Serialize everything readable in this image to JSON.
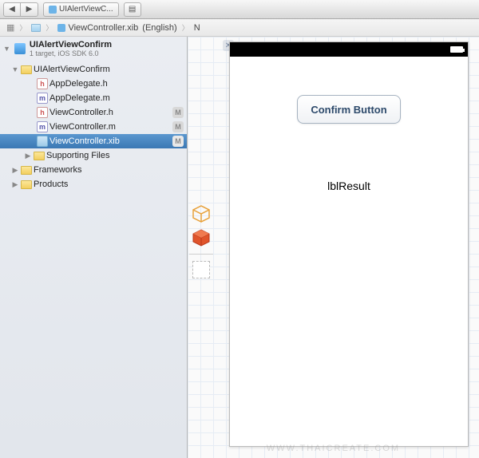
{
  "toolbar": {
    "tab_label": "UIAlertViewC..."
  },
  "breadcrumb": {
    "seg1": "ViewController.xib",
    "seg2": "(English)",
    "seg3_prefix": "N"
  },
  "project": {
    "name": "UIAlertViewConfirm",
    "subtitle": "1 target, iOS SDK 6.0"
  },
  "tree": {
    "root": "UIAlertViewConfirm",
    "files": [
      {
        "name": "AppDelegate.h",
        "type": "h",
        "badge": ""
      },
      {
        "name": "AppDelegate.m",
        "type": "m",
        "badge": ""
      },
      {
        "name": "ViewController.h",
        "type": "h",
        "badge": "M"
      },
      {
        "name": "ViewController.m",
        "type": "m",
        "badge": "M"
      },
      {
        "name": "ViewController.xib",
        "type": "xib",
        "badge": "M",
        "selected": true
      }
    ],
    "supporting": "Supporting Files",
    "frameworks": "Frameworks",
    "products": "Products"
  },
  "canvas": {
    "button_label": "Confirm Button",
    "label_text": "lblResult"
  },
  "watermark": "WWW.THAICREATE.COM"
}
